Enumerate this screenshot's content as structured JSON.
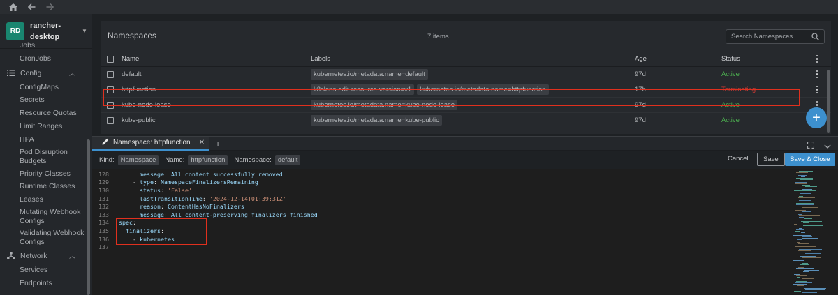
{
  "topbar": {
    "icons": [
      "home-icon",
      "back-arrow-icon",
      "forward-arrow-icon"
    ]
  },
  "cluster": {
    "badge": "RD",
    "name": "rancher-desktop"
  },
  "sidebar": {
    "items_top": [
      "Jobs",
      "CronJobs"
    ],
    "config_group": "Config",
    "config_items": [
      "ConfigMaps",
      "Secrets",
      "Resource Quotas",
      "Limit Ranges",
      "HPA",
      "Pod Disruption Budgets",
      "Priority Classes",
      "Runtime Classes",
      "Leases",
      "Mutating Webhook Configs",
      "Validating Webhook Configs"
    ],
    "network_group": "Network",
    "network_items": [
      "Services",
      "Endpoints"
    ]
  },
  "namespaces": {
    "title": "Namespaces",
    "count": "7 items",
    "search_placeholder": "Search Namespaces...",
    "columns": [
      "Name",
      "Labels",
      "Age",
      "Status"
    ],
    "rows": [
      {
        "name": "default",
        "labels": [
          "kubernetes.io/metadata.name=default"
        ],
        "age": "97d",
        "status": "Active"
      },
      {
        "name": "httpfunction",
        "labels": [
          "k8slens-edit-resource-version=v1",
          "kubernetes.io/metadata.name=httpfunction"
        ],
        "age": "17h",
        "status": "Terminating"
      },
      {
        "name": "kube-node-lease",
        "labels": [
          "kubernetes.io/metadata.name=kube-node-lease"
        ],
        "age": "97d",
        "status": "Active"
      },
      {
        "name": "kube-public",
        "labels": [
          "kubernetes.io/metadata.name=kube-public"
        ],
        "age": "97d",
        "status": "Active"
      }
    ]
  },
  "dock": {
    "tab_label": "Namespace: httpfunction",
    "kind_label": "Kind:",
    "kind_value": "Namespace",
    "name_label": "Name:",
    "name_value": "httpfunction",
    "ns_label": "Namespace:",
    "ns_value": "default",
    "cancel": "Cancel",
    "save": "Save",
    "save_close": "Save & Close"
  },
  "editor": {
    "lines": [
      {
        "n": "128",
        "indent": "      ",
        "key": "message",
        "val": " All content successfully removed",
        "kind": "text"
      },
      {
        "n": "129",
        "indent": "    - ",
        "key": "type",
        "val": " NamespaceFinalizersRemaining",
        "kind": "text"
      },
      {
        "n": "130",
        "indent": "      ",
        "key": "status",
        "val": " 'False'",
        "kind": "str"
      },
      {
        "n": "131",
        "indent": "      ",
        "key": "lastTransitionTime",
        "val": " '2024-12-14T01:39:31Z'",
        "kind": "str"
      },
      {
        "n": "132",
        "indent": "      ",
        "key": "reason",
        "val": " ContentHasNoFinalizers",
        "kind": "text"
      },
      {
        "n": "133",
        "indent": "      ",
        "key": "message",
        "val": " All content-preserving finalizers finished",
        "kind": "text"
      },
      {
        "n": "134",
        "indent": "",
        "key": "spec",
        "val": "",
        "kind": "text"
      },
      {
        "n": "135",
        "indent": "  ",
        "key": "finalizers",
        "val": "",
        "kind": "text"
      },
      {
        "n": "136",
        "indent": "    - ",
        "key": "",
        "val": "kubernetes",
        "kind": "text"
      },
      {
        "n": "137",
        "indent": "",
        "key": "",
        "val": "",
        "kind": "text"
      }
    ]
  },
  "colors": {
    "accent": "#3d90ce",
    "active": "#4caf50",
    "terminating": "#ce3933",
    "highlight": "#e0301e",
    "cluster_badge": "#198670"
  }
}
